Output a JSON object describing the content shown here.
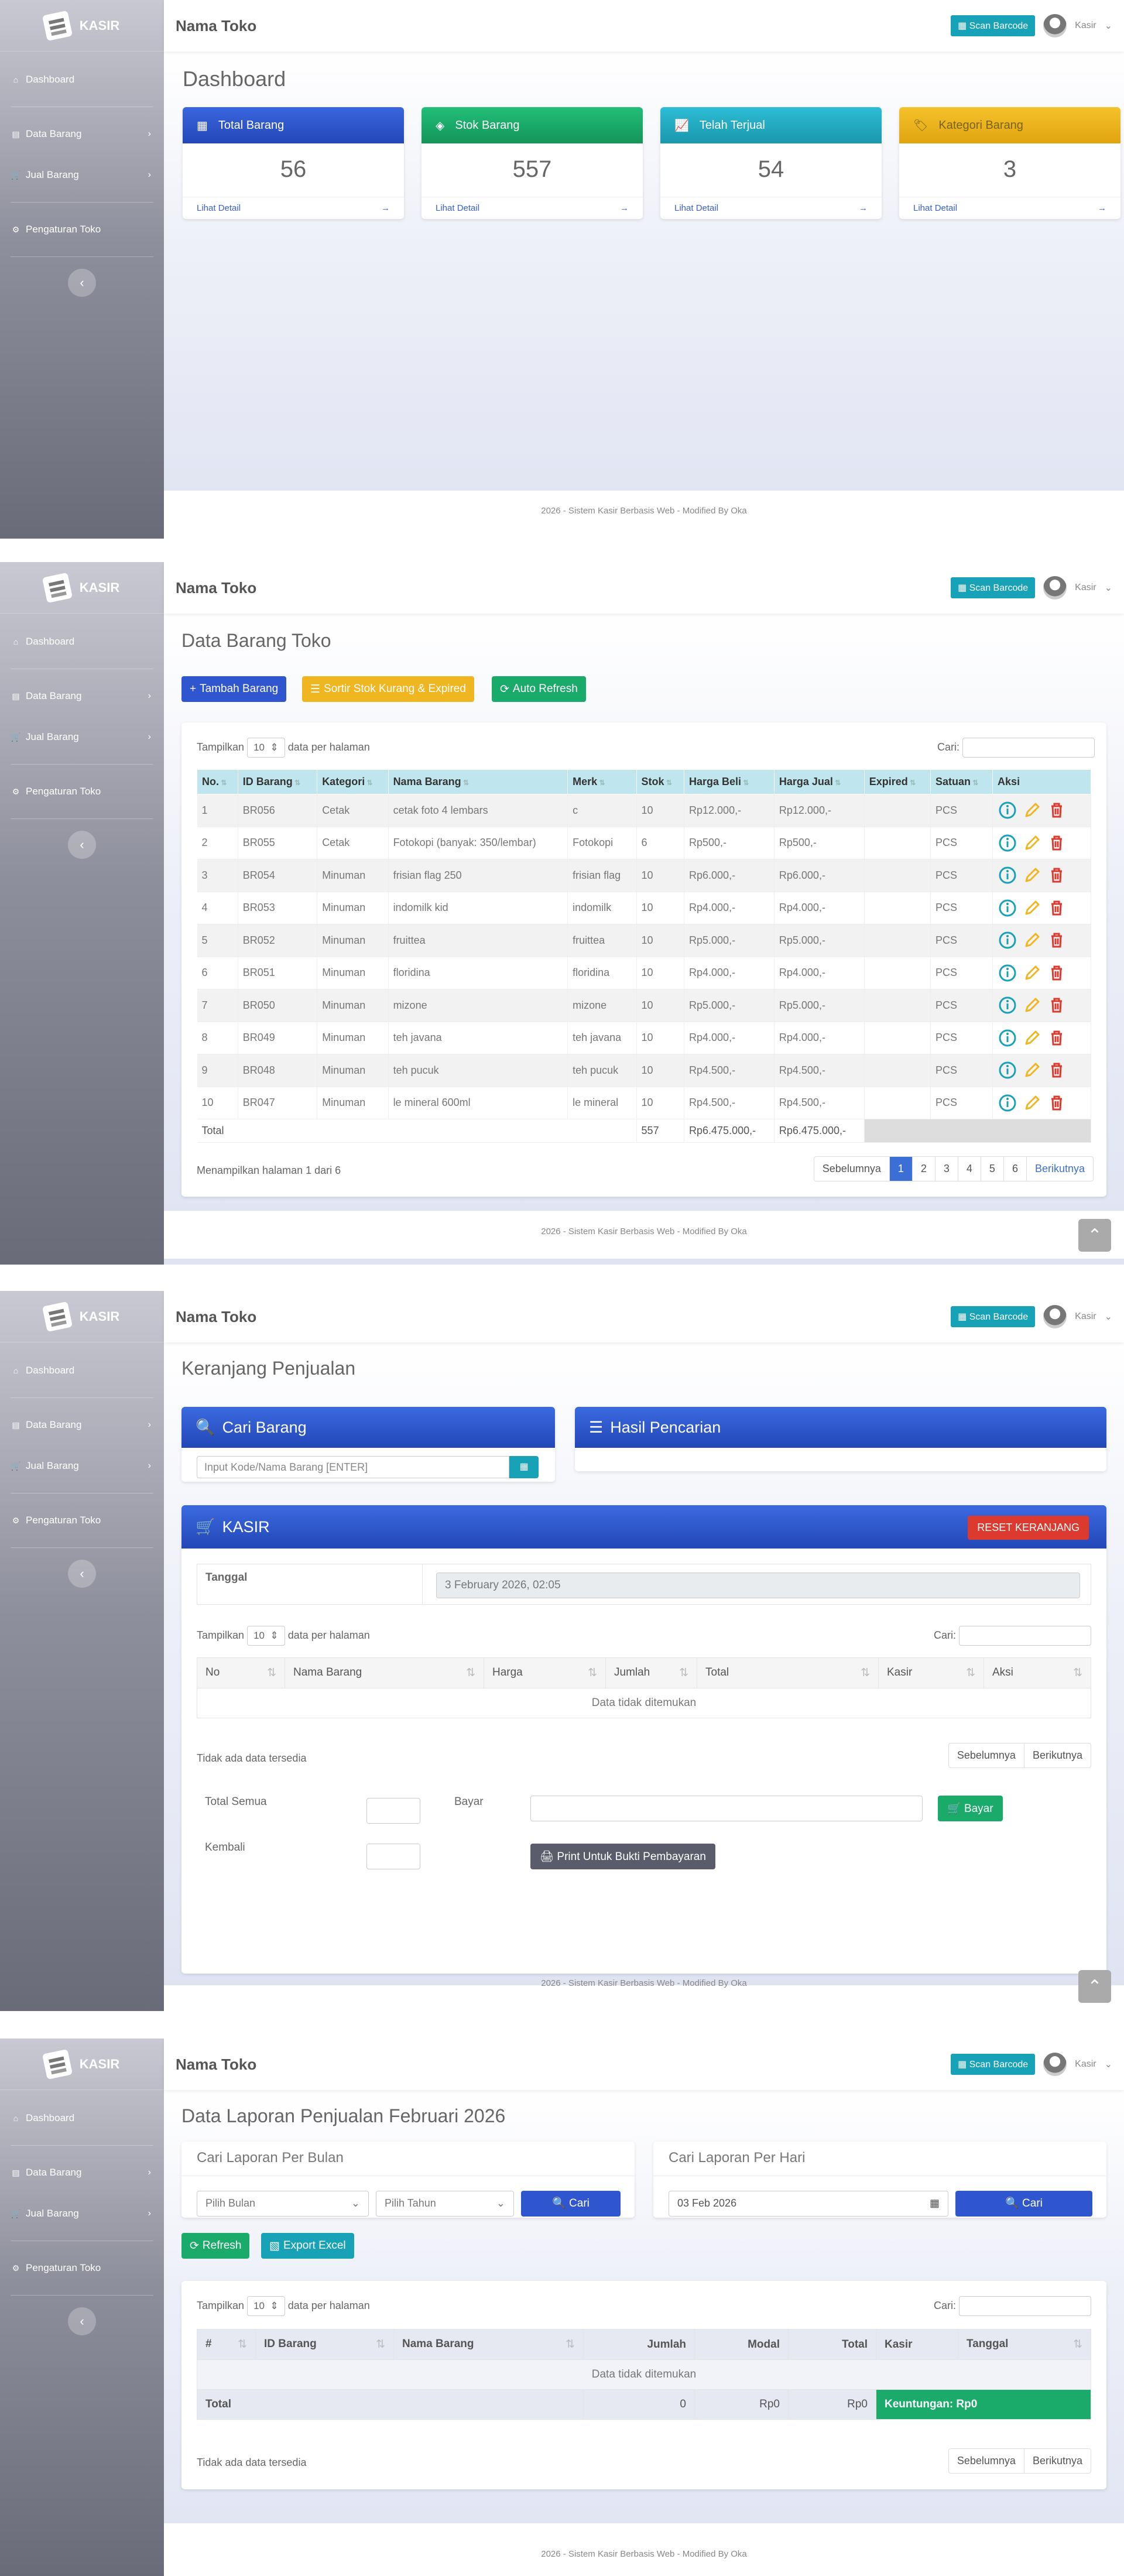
{
  "app": {
    "brand": "KASIR",
    "store": "Nama Toko",
    "scan": "Scan Barcode",
    "user": "Kasir"
  },
  "nav": {
    "dashboard": "Dashboard",
    "data_barang": "Data Barang",
    "jual_barang": "Jual Barang",
    "pengaturan": "Pengaturan Toko"
  },
  "footer": "2026 - Sistem Kasir Berbasis Web - Modified By Oka",
  "dashboard": {
    "title": "Dashboard",
    "detail": "Lihat Detail",
    "cards": [
      {
        "label": "Total Barang",
        "value": "56",
        "color": "#2f55cf"
      },
      {
        "label": "Stok Barang",
        "value": "557",
        "color": "#1aab6b"
      },
      {
        "label": "Telah Terjual",
        "value": "54",
        "color": "#21a9c1"
      },
      {
        "label": "Kategori Barang",
        "value": "3",
        "color": "#f0b621"
      }
    ]
  },
  "barang": {
    "title": "Data Barang Toko",
    "btn_tambah": "Tambah Barang",
    "btn_sortir": "Sortir Stok Kurang & Expired",
    "btn_refresh": "Auto Refresh",
    "show": "Tampilkan",
    "len": "10",
    "per": "data per halaman",
    "search": "Cari:",
    "columns": [
      "No.",
      "ID Barang",
      "Kategori",
      "Nama Barang",
      "Merk",
      "Stok",
      "Harga Beli",
      "Harga Jual",
      "Expired",
      "Satuan",
      "Aksi"
    ],
    "rows": [
      [
        "1",
        "BR056",
        "Cetak",
        "cetak foto 4 lembars",
        "c",
        "10",
        "Rp12.000,-",
        "Rp12.000,-",
        "",
        "PCS"
      ],
      [
        "2",
        "BR055",
        "Cetak",
        "Fotokopi (banyak: 350/lembar)",
        "Fotokopi",
        "6",
        "Rp500,-",
        "Rp500,-",
        "",
        "PCS"
      ],
      [
        "3",
        "BR054",
        "Minuman",
        "frisian flag 250",
        "frisian flag",
        "10",
        "Rp6.000,-",
        "Rp6.000,-",
        "",
        "PCS"
      ],
      [
        "4",
        "BR053",
        "Minuman",
        "indomilk kid",
        "indomilk",
        "10",
        "Rp4.000,-",
        "Rp4.000,-",
        "",
        "PCS"
      ],
      [
        "5",
        "BR052",
        "Minuman",
        "fruittea",
        "fruittea",
        "10",
        "Rp5.000,-",
        "Rp5.000,-",
        "",
        "PCS"
      ],
      [
        "6",
        "BR051",
        "Minuman",
        "floridina",
        "floridina",
        "10",
        "Rp4.000,-",
        "Rp4.000,-",
        "",
        "PCS"
      ],
      [
        "7",
        "BR050",
        "Minuman",
        "mizone",
        "mizone",
        "10",
        "Rp5.000,-",
        "Rp5.000,-",
        "",
        "PCS"
      ],
      [
        "8",
        "BR049",
        "Minuman",
        "teh javana",
        "teh javana",
        "10",
        "Rp4.000,-",
        "Rp4.000,-",
        "",
        "PCS"
      ],
      [
        "9",
        "BR048",
        "Minuman",
        "teh pucuk",
        "teh pucuk",
        "10",
        "Rp4.500,-",
        "Rp4.500,-",
        "",
        "PCS"
      ],
      [
        "10",
        "BR047",
        "Minuman",
        "le mineral 600ml",
        "le mineral",
        "10",
        "Rp4.500,-",
        "Rp4.500,-",
        "",
        "PCS"
      ]
    ],
    "total_label": "Total",
    "total_stok": "557",
    "total_beli": "Rp6.475.000,-",
    "total_jual": "Rp6.475.000,-",
    "info": "Menampilkan halaman 1 dari 6",
    "prev": "Sebelumnya",
    "next": "Berikutnya",
    "pages": [
      "1",
      "2",
      "3",
      "4",
      "5",
      "6"
    ]
  },
  "jual": {
    "title": "Keranjang Penjualan",
    "cari": "Cari Barang",
    "hasil": "Hasil Pencarian",
    "placeholder": "Input Kode/Nama Barang [ENTER]",
    "kasir": "KASIR",
    "reset": "RESET KERANJANG",
    "tanggal_label": "Tanggal",
    "tanggal": "3 February 2026, 02:05",
    "show": "Tampilkan",
    "len": "10",
    "per": "data per halaman",
    "search": "Cari:",
    "columns": [
      "No",
      "Nama Barang",
      "Harga",
      "Jumlah",
      "Total",
      "Kasir",
      "Aksi"
    ],
    "empty": "Data tidak ditemukan",
    "none": "Tidak ada data tersedia",
    "prev": "Sebelumnya",
    "next": "Berikutnya",
    "total_semua": "Total Semua",
    "bayar_label": "Bayar",
    "bayar_btn": "Bayar",
    "kembali": "Kembali",
    "print": "Print Untuk Bukti Pembayaran"
  },
  "laporan": {
    "title": "Data Laporan Penjualan Februari 2026",
    "per_bulan": "Cari Laporan Per Bulan",
    "per_hari": "Cari Laporan Per Hari",
    "pilih_bulan": "Pilih Bulan",
    "pilih_tahun": "Pilih Tahun",
    "cari": "Cari",
    "tanggal": "03 Feb 2026",
    "refresh": "Refresh",
    "export": "Export Excel",
    "show": "Tampilkan",
    "len": "10",
    "per": "data per halaman",
    "search": "Cari:",
    "columns": [
      "#",
      "ID Barang",
      "Nama Barang",
      "Jumlah",
      "Modal",
      "Total",
      "Kasir",
      "Tanggal"
    ],
    "empty": "Data tidak ditemukan",
    "total": "Total",
    "jumlah": "0",
    "modal": "Rp0",
    "totalv": "Rp0",
    "keuntungan": "Keuntungan: Rp0",
    "none": "Tidak ada data tersedia",
    "prev": "Sebelumnya",
    "next": "Berikutnya"
  }
}
